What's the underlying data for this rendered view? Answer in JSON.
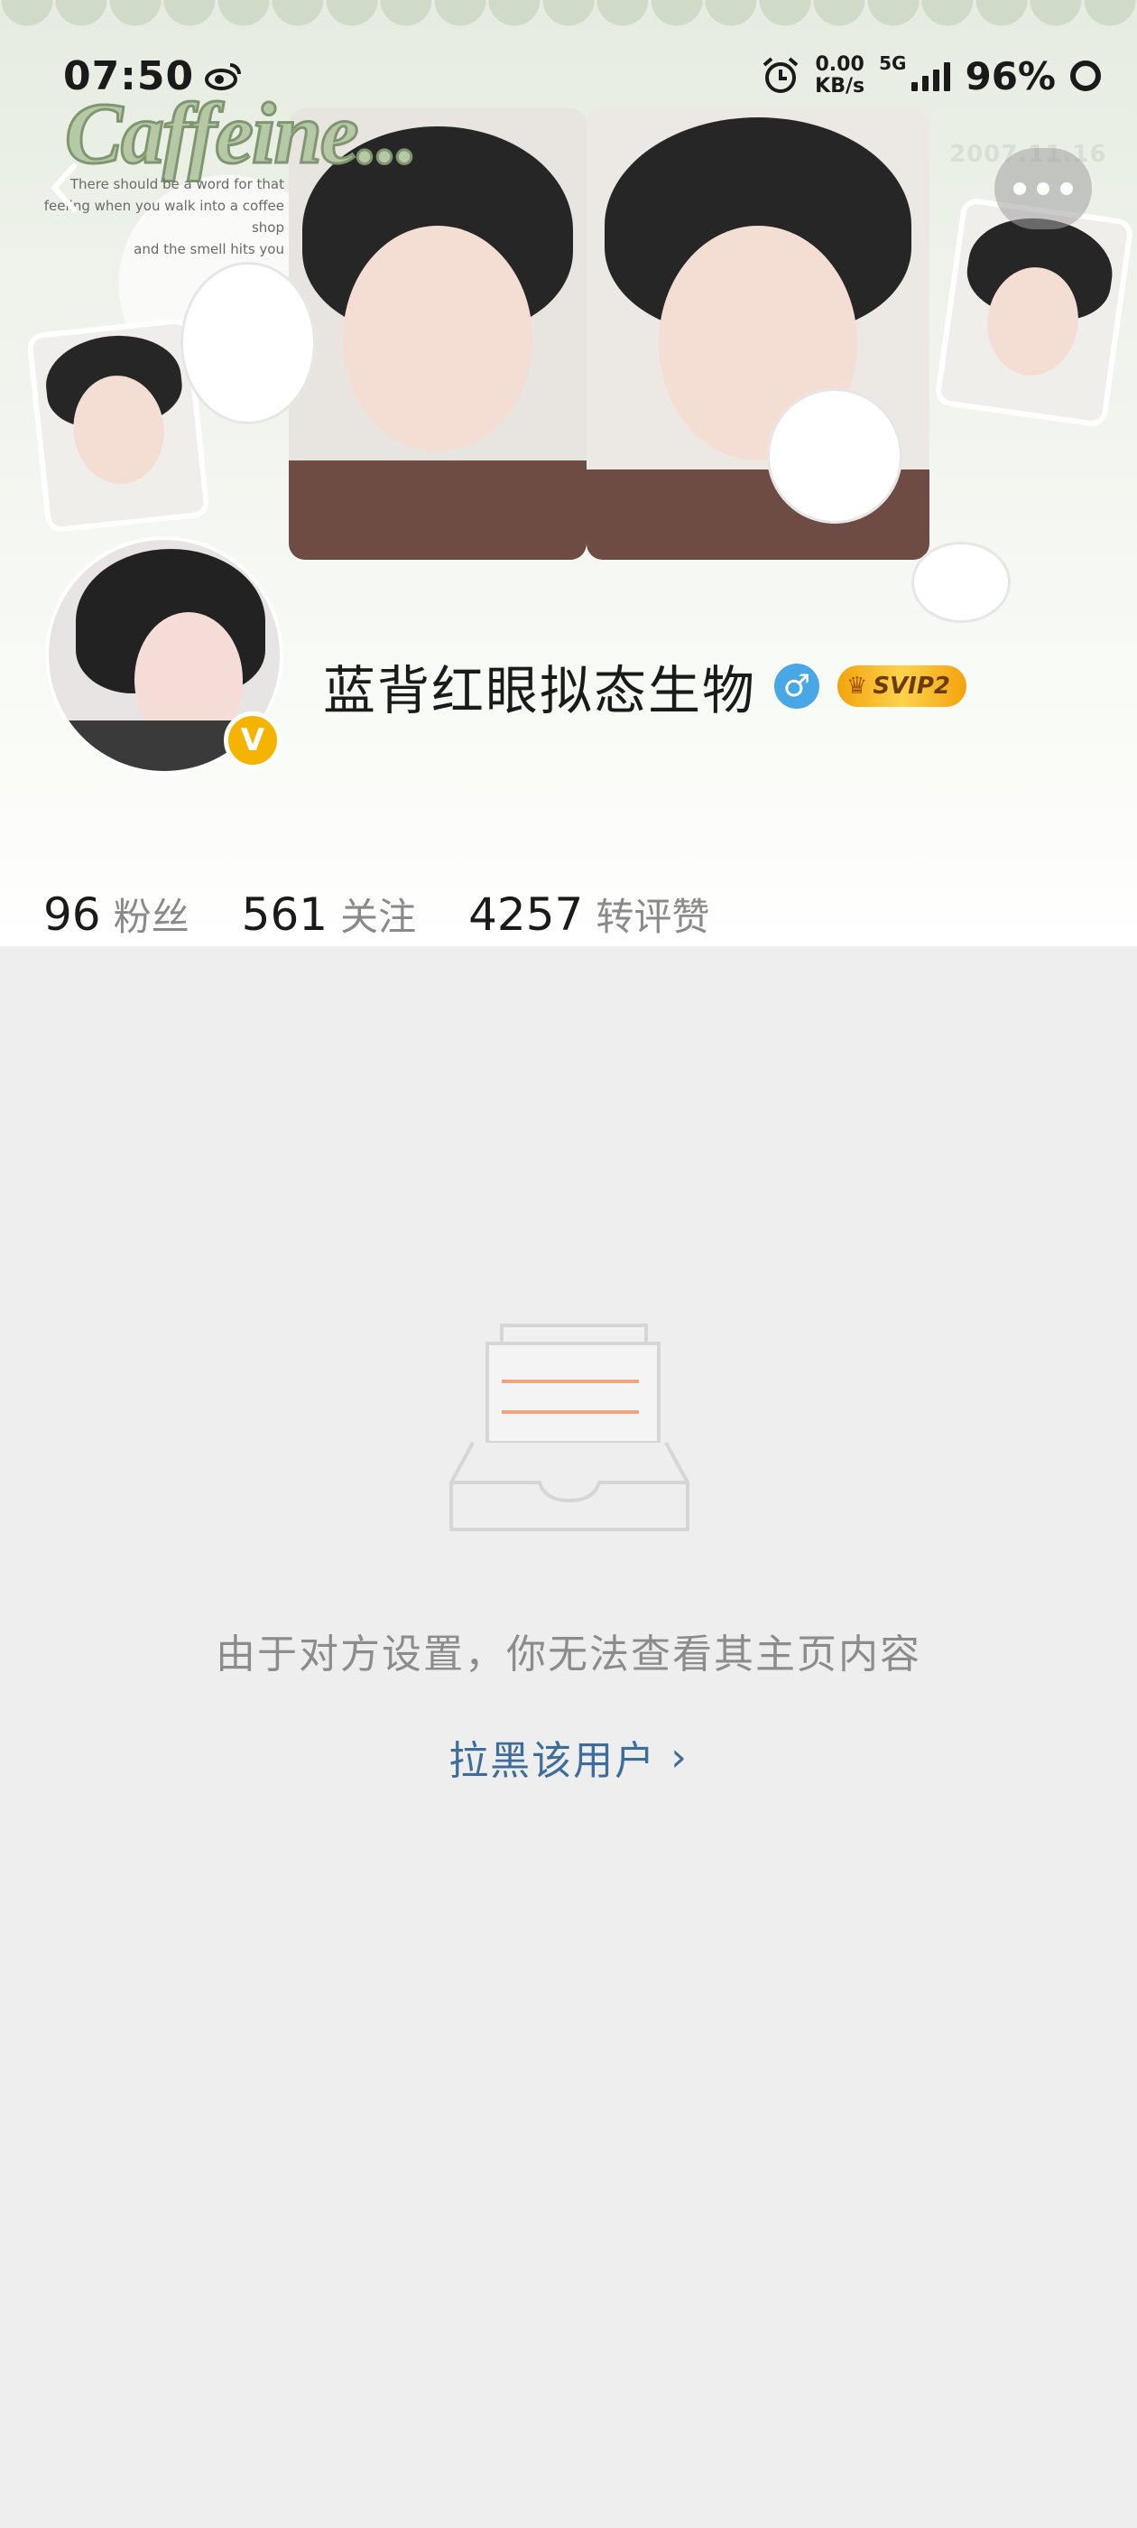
{
  "status_bar": {
    "time": "07:50",
    "net_speed_value": "0.00",
    "net_speed_unit": "KB/s",
    "network_type": "5G",
    "battery_percent": "96%"
  },
  "cover": {
    "title_text": "Caffeine...",
    "quote_lines": [
      "There should be a word for that",
      "feeling when you walk into a coffee shop",
      "and the smell hits you"
    ],
    "date_text": "2007.11.16"
  },
  "profile": {
    "username": "蓝背红眼拟态生物",
    "verified_badge": "V",
    "gender_symbol": "♂",
    "vip_label": "SVIP2"
  },
  "stats": [
    {
      "value": "96",
      "label": "粉丝"
    },
    {
      "value": "561",
      "label": "关注"
    },
    {
      "value": "4257",
      "label": "转评赞"
    }
  ],
  "empty_state": {
    "message": "由于对方设置，你无法查看其主页内容",
    "block_link": "拉黑该用户",
    "block_link_chevron": "›"
  },
  "colors": {
    "background": "#eeeeee",
    "link": "#3c6d9c",
    "vip_gold": "#f2a30c",
    "verified_gold": "#f5b400",
    "gender_blue": "#4aa7e6"
  },
  "icons": [
    "alarm-icon",
    "signal-icon",
    "back-icon",
    "more-icon",
    "weibo-icon",
    "empty-box-icon"
  ]
}
